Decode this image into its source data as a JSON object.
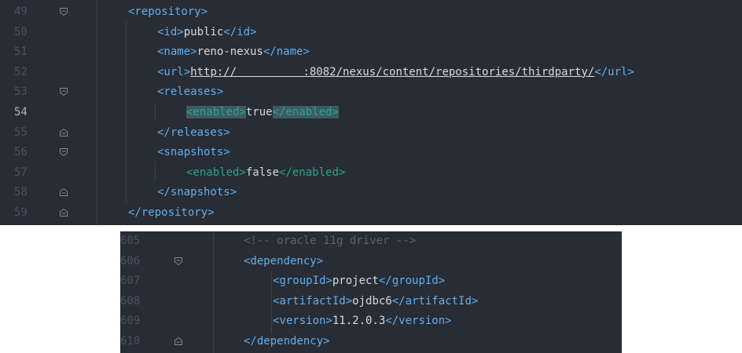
{
  "top_editor": {
    "lines": [
      {
        "num": "49",
        "fold": "open",
        "indent": 0,
        "parts": [
          {
            "t": "<repository>",
            "c": "tag"
          }
        ]
      },
      {
        "num": "50",
        "fold": "",
        "indent": 1,
        "parts": [
          {
            "t": "<id>",
            "c": "tag"
          },
          {
            "t": "public",
            "c": "txt"
          },
          {
            "t": "</id>",
            "c": "tag"
          }
        ]
      },
      {
        "num": "51",
        "fold": "",
        "indent": 1,
        "parts": [
          {
            "t": "<name>",
            "c": "tag"
          },
          {
            "t": "reno-nexus",
            "c": "txt"
          },
          {
            "t": "</name>",
            "c": "tag"
          }
        ]
      },
      {
        "num": "52",
        "fold": "",
        "indent": 1,
        "parts": [
          {
            "t": "<url>",
            "c": "tag"
          },
          {
            "t": "http://          :8082/nexus/content/repositories/thirdparty/",
            "c": "url"
          },
          {
            "t": "</url>",
            "c": "tag"
          }
        ]
      },
      {
        "num": "53",
        "fold": "open",
        "indent": 1,
        "parts": [
          {
            "t": "<releases>",
            "c": "tag"
          }
        ]
      },
      {
        "num": "54",
        "fold": "",
        "indent": 2,
        "active": true,
        "parts": [
          {
            "t": "<enabled>",
            "c": "tag-green hl"
          },
          {
            "t": "true",
            "c": "txt"
          },
          {
            "t": "</enabled>",
            "c": "tag-green hl"
          }
        ]
      },
      {
        "num": "55",
        "fold": "close",
        "indent": 1,
        "parts": [
          {
            "t": "</releases>",
            "c": "tag"
          }
        ]
      },
      {
        "num": "56",
        "fold": "open",
        "indent": 1,
        "parts": [
          {
            "t": "<snapshots>",
            "c": "tag"
          }
        ]
      },
      {
        "num": "57",
        "fold": "",
        "indent": 2,
        "parts": [
          {
            "t": "<enabled>",
            "c": "tag-green"
          },
          {
            "t": "false",
            "c": "txt"
          },
          {
            "t": "</enabled>",
            "c": "tag-green"
          }
        ]
      },
      {
        "num": "58",
        "fold": "close",
        "indent": 1,
        "parts": [
          {
            "t": "</snapshots>",
            "c": "tag"
          }
        ]
      },
      {
        "num": "59",
        "fold": "close",
        "indent": 0,
        "parts": [
          {
            "t": "</repository>",
            "c": "tag"
          }
        ]
      }
    ]
  },
  "bottom_editor": {
    "lines": [
      {
        "num": "605",
        "fold": "",
        "indent": 0,
        "parts": [
          {
            "t": "<!-- oracle 11g driver -->",
            "c": "cm"
          }
        ]
      },
      {
        "num": "606",
        "fold": "open",
        "indent": 0,
        "parts": [
          {
            "t": "<dependency>",
            "c": "tag"
          }
        ]
      },
      {
        "num": "607",
        "fold": "",
        "indent": 1,
        "parts": [
          {
            "t": "<groupId>",
            "c": "tag"
          },
          {
            "t": "project",
            "c": "txt"
          },
          {
            "t": "</groupId>",
            "c": "tag"
          }
        ]
      },
      {
        "num": "608",
        "fold": "",
        "indent": 1,
        "parts": [
          {
            "t": "<artifactId>",
            "c": "tag"
          },
          {
            "t": "ojdbc6",
            "c": "txt"
          },
          {
            "t": "</artifactId>",
            "c": "tag"
          }
        ]
      },
      {
        "num": "609",
        "fold": "",
        "indent": 1,
        "parts": [
          {
            "t": "<version>",
            "c": "tag"
          },
          {
            "t": "11.2.0.3",
            "c": "txt"
          },
          {
            "t": "</version>",
            "c": "tag"
          }
        ]
      },
      {
        "num": "610",
        "fold": "close",
        "indent": 0,
        "parts": [
          {
            "t": "</dependency>",
            "c": "tag"
          }
        ]
      }
    ]
  },
  "colors": {
    "background": "#282c34",
    "tag": "#61afef",
    "tag_green": "#24a890",
    "text": "#d7dae0",
    "comment": "#5c6370"
  }
}
